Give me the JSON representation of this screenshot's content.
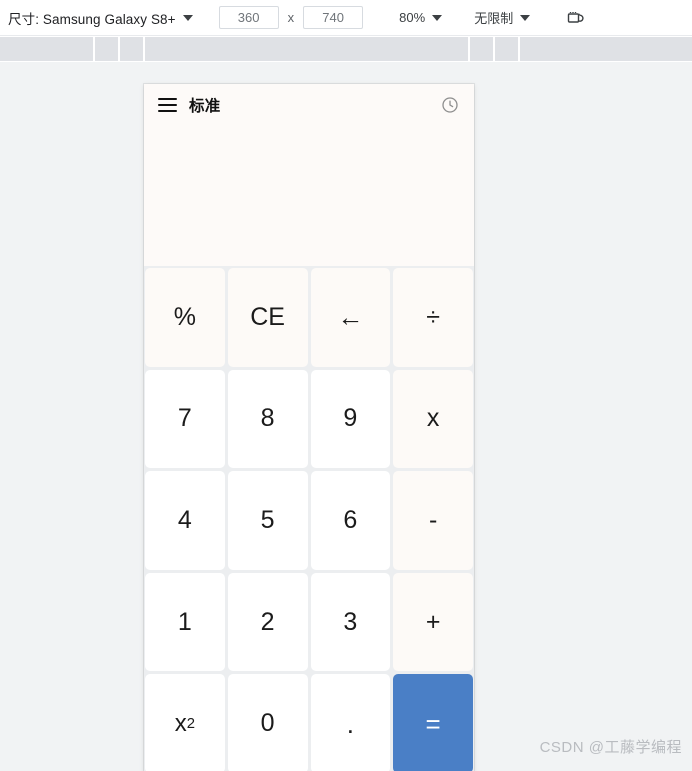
{
  "toolbar": {
    "device_label": "尺寸: Samsung Galaxy S8+",
    "width_value": "360",
    "height_value": "740",
    "multiply_symbol": "x",
    "zoom_label": "80%",
    "throttle_label": "无限制",
    "rotate_icon": "rotate-device-icon",
    "caret_icon": "chevron-down-icon"
  },
  "app": {
    "menu_icon": "hamburger-menu-icon",
    "title": "标准",
    "history_icon": "clock-history-icon",
    "display_value": ""
  },
  "keypad": {
    "keys": [
      {
        "label": "%",
        "name": "key-percent",
        "type": "fn"
      },
      {
        "label": "CE",
        "name": "key-clear-entry",
        "type": "fn"
      },
      {
        "label": "←",
        "name": "key-backspace",
        "type": "fn"
      },
      {
        "label": "÷",
        "name": "key-divide",
        "type": "op"
      },
      {
        "label": "7",
        "name": "key-7",
        "type": "num"
      },
      {
        "label": "8",
        "name": "key-8",
        "type": "num"
      },
      {
        "label": "9",
        "name": "key-9",
        "type": "num"
      },
      {
        "label": "x",
        "name": "key-multiply",
        "type": "op"
      },
      {
        "label": "4",
        "name": "key-4",
        "type": "num"
      },
      {
        "label": "5",
        "name": "key-5",
        "type": "num"
      },
      {
        "label": "6",
        "name": "key-6",
        "type": "num"
      },
      {
        "label": "-",
        "name": "key-subtract",
        "type": "op"
      },
      {
        "label": "1",
        "name": "key-1",
        "type": "num"
      },
      {
        "label": "2",
        "name": "key-2",
        "type": "num"
      },
      {
        "label": "3",
        "name": "key-3",
        "type": "num"
      },
      {
        "label": "+",
        "name": "key-add",
        "type": "op"
      },
      {
        "label": "x²",
        "name": "key-square",
        "type": "num"
      },
      {
        "label": "0",
        "name": "key-0",
        "type": "num"
      },
      {
        "label": ".",
        "name": "key-decimal",
        "type": "num"
      },
      {
        "label": "=",
        "name": "key-equals",
        "type": "equals"
      }
    ]
  },
  "watermark": {
    "text": "CSDN @工藤学编程"
  },
  "colors": {
    "accent_blue": "#4a7fc6",
    "key_white": "#ffffff",
    "key_offwhite": "#fdfaf7",
    "canvas_gray": "#f1f3f4",
    "ruler_gray": "#dfe1e5",
    "watermark_gray": "#b9bcc0"
  },
  "ruler": {
    "tick_positions": [
      93,
      118,
      143,
      468,
      493,
      518
    ]
  }
}
